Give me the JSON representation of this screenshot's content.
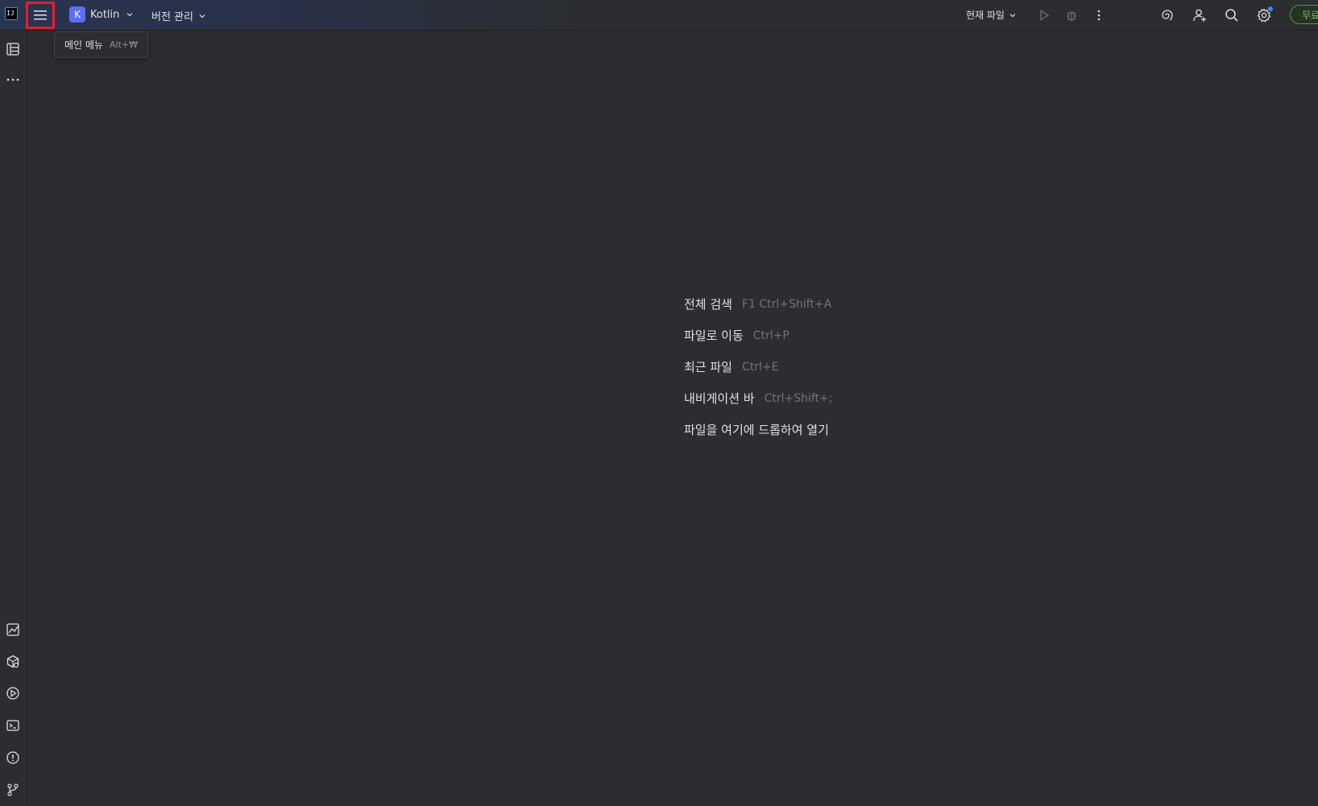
{
  "titlebar": {
    "app_logo": "IJ",
    "main_menu_icon": "hamburger-menu-icon",
    "project": {
      "badge": "K",
      "name": "Kotlin"
    },
    "vcs_label": "버전 관리",
    "run_config_label": "현재 파일",
    "upgrade_label": "무료"
  },
  "tooltip": {
    "label": "메인 메뉴",
    "shortcut": "Alt+₩"
  },
  "left_strip": {
    "top_icons": [
      "project-structure-icon",
      "more-icon"
    ],
    "bottom_icons": [
      "profiler-icon",
      "services-icon",
      "run-icon",
      "terminal-icon",
      "problems-icon",
      "git-icon"
    ]
  },
  "welcome_hints": [
    {
      "label": "전체 검색",
      "shortcut": "F1 Ctrl+Shift+A"
    },
    {
      "label": "파일로 이동",
      "shortcut": "Ctrl+P"
    },
    {
      "label": "최근 파일",
      "shortcut": "Ctrl+E"
    },
    {
      "label": "내비게이션 바",
      "shortcut": "Ctrl+Shift+;"
    },
    {
      "label": "파일을 여기에 드롭하여 열기",
      "shortcut": ""
    }
  ],
  "colors": {
    "background": "#2b2d30",
    "highlight_border": "#e0212a",
    "project_badge": "#5c6ff2",
    "upgrade_green": "#6ac06a"
  }
}
